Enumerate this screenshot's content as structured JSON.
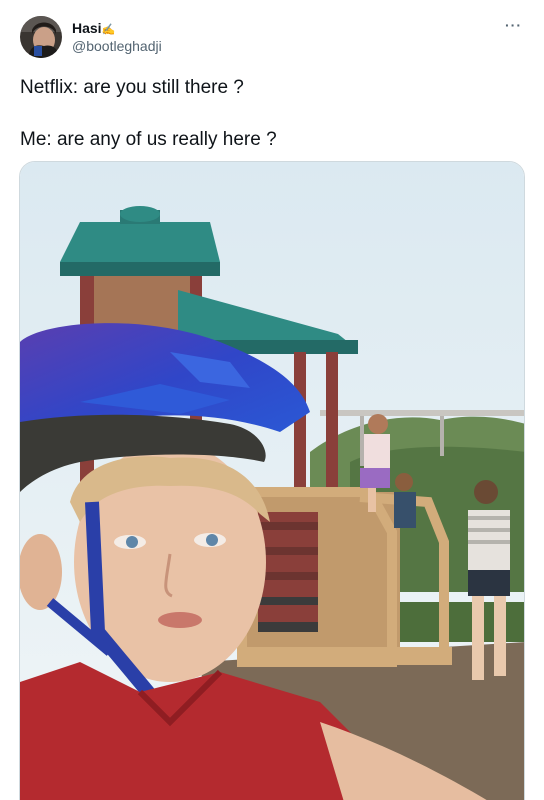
{
  "tweet": {
    "display_name": "Hasi",
    "display_name_suffix": "·",
    "handle": "@bootleghadji",
    "more_label": "···",
    "text_lines": [
      "Netflix: are you still there ?",
      "Me: are any of us really here ?"
    ],
    "icons": {
      "more": "more-options-icon",
      "avatar": "avatar-image"
    },
    "colors": {
      "text": "#0f1419",
      "secondary_text": "#536471",
      "border": "#cfd9de"
    }
  }
}
